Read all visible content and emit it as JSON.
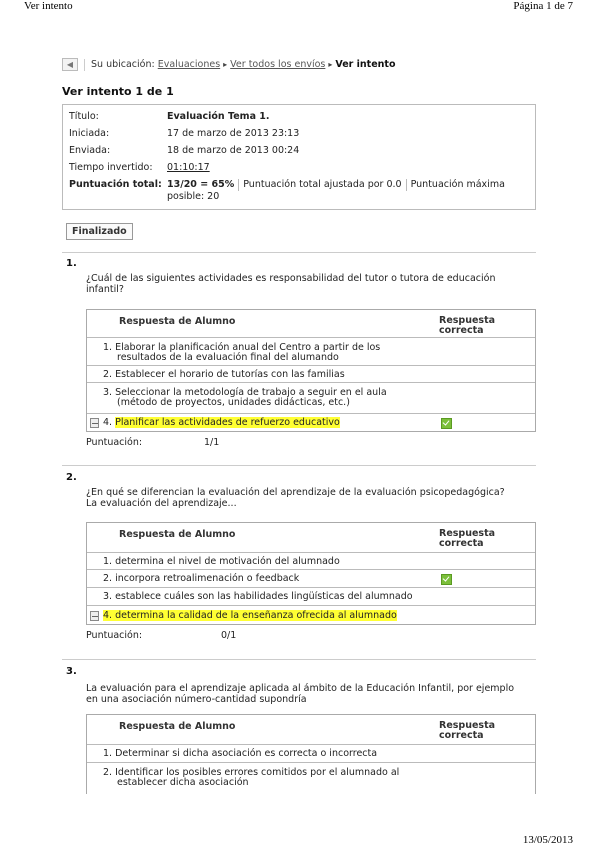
{
  "print_header": {
    "left": "Ver intento",
    "right": "Página 1 de 7"
  },
  "print_footer": {
    "date": "13/05/2013"
  },
  "breadcrumb": {
    "prefix": "Su ubicación:",
    "items": [
      "Evaluaciones",
      "Ver todos los envíos"
    ],
    "current": "Ver intento"
  },
  "attempt_title": "Ver intento 1 de 1",
  "info": {
    "title_label": "Título:",
    "title_value": "Evaluación Tema 1.",
    "started_label": "Iniciada:",
    "started_value": "17 de marzo de 2013 23:13",
    "sent_label": "Enviada:",
    "sent_value": "18 de marzo de 2013 00:24",
    "time_label": "Tiempo invertido:",
    "time_value": "01:10:17",
    "score_label": "Puntuación total:",
    "score_value": "13/20 = 65%",
    "adjusted": "Puntuación total ajustada por 0.0",
    "max_1": "Puntuación máxima",
    "max_2": "posible: 20"
  },
  "status": "Finalizado",
  "headers": {
    "student": "Respuesta de Alumno",
    "correct_1": "Respuesta",
    "correct_2": "correcta"
  },
  "score_label": "Puntuación:",
  "questions": [
    {
      "num": "1.",
      "text_1": "¿Cuál de las siguientes actividades es responsabilidad del tutor o tutora de educación",
      "text_2": "infantil?",
      "options": [
        {
          "l1": "1. Elaborar la planificación anual del Centro a partir de los",
          "l2": "resultados de la evaluación final del alumando"
        },
        {
          "l1": "2. Establecer el horario de tutorías con las familias"
        },
        {
          "l1": "3. Seleccionar la metodología de trabajo a seguir en el aula",
          "l2": "(método de proyectos, unidades didácticas, etc.)"
        },
        {
          "num": "4.",
          "l1": "Planificar las actividades de refuerzo educativo"
        }
      ],
      "score": "1/1"
    },
    {
      "num": "2.",
      "text_1": "¿En qué se diferencian la evaluación del aprendizaje de la evaluación psicopedagógica?",
      "text_2": "La evaluación del aprendizaje...",
      "options": [
        {
          "l1": "1. determina el nivel de motivación del alumnado"
        },
        {
          "l1": "2. incorpora retroalimenación o feedback"
        },
        {
          "l1": "3. establece cuáles son las habilidades lingüísticas del alumnado"
        },
        {
          "num": "4.",
          "l1": "determina la calidad de la enseñanza ofrecida al alumnado"
        }
      ],
      "score": "0/1"
    },
    {
      "num": "3.",
      "text_1": "La evaluación para el aprendizaje aplicada al ámbito de la Educación Infantil, por ejemplo",
      "text_2": "en una asociación número-cantidad supondría",
      "options": [
        {
          "l1": "1. Determinar si dicha asociación es correcta o incorrecta"
        },
        {
          "l1": "2. Identificar los posibles errores comitidos por el alumnado al",
          "l2": "establecer dicha asociación"
        }
      ]
    }
  ]
}
